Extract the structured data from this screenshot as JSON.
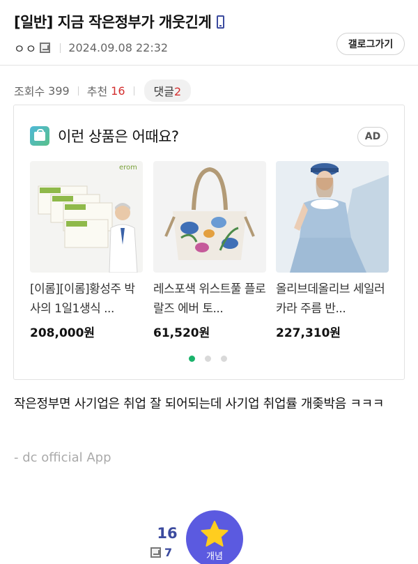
{
  "post": {
    "title": "[일반] 지금 작은정부가 개웃긴게",
    "nickname": "ㅇㅇ",
    "date": "2024.09.08 22:32",
    "gallery_button": "갤로그가기",
    "views_label": "조회수",
    "views": "399",
    "recommend_label": "추천",
    "recommend": "16",
    "comments_label": "댓글",
    "comments": "2",
    "body": "작은정부면 사기업은 취업 잘 되어되는데 사기업 취업률 개좆박음 ㅋㅋㅋ",
    "signature": "- dc official App"
  },
  "ad": {
    "title": "이런 상품은 어때요?",
    "badge": "AD",
    "products": [
      {
        "name": "[이롬][이롬]황성주 박사의 1일1생식 ...",
        "price": "208,000원",
        "brand": "erom"
      },
      {
        "name": "레스포색 위스트풀 플로랄즈 에버 토...",
        "price": "61,520원"
      },
      {
        "name": "올리브데올리브 세일러카라 주름 반...",
        "price": "227,310원"
      }
    ],
    "active_dot": 0
  },
  "vote": {
    "count": "16",
    "fixed_count": "7",
    "button_label": "개념"
  },
  "colors": {
    "accent": "#5b5ae0",
    "nav_blue": "#3b4a9e",
    "red": "#d32f2f",
    "green_dot": "#1ab36b"
  }
}
